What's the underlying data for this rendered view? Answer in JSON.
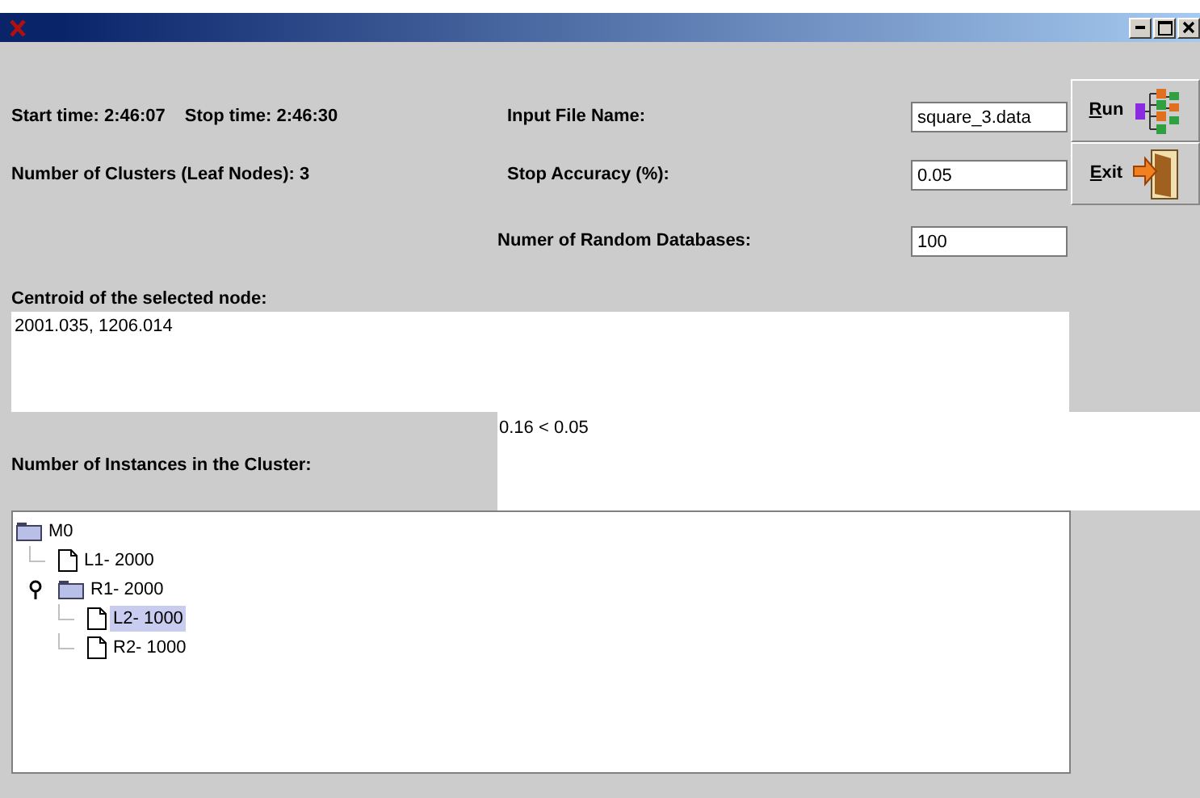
{
  "start_time": "Start time: 2:46:07",
  "stop_time": "Stop time: 2:46:30",
  "clusters": "Number of Clusters (Leaf Nodes): 3",
  "fields": [
    {
      "label": "Input File Name:",
      "value": "square_3.data"
    },
    {
      "label": "Stop Accuracy (%):",
      "value": "0.05"
    },
    {
      "label": "Numer of Random Databases:",
      "value": "100"
    }
  ],
  "buttons": [
    {
      "mnemonic": "R",
      "rest": "un",
      "kind": "run"
    },
    {
      "mnemonic": "E",
      "rest": "xit",
      "kind": "exit"
    }
  ],
  "centroid": {
    "label": "Centroid of the selected node:",
    "value": "2001.035, 1206.014"
  },
  "instances": {
    "label": "Number of Instances in the Cluster:",
    "result": "0.16 < 0.05"
  },
  "tree": [
    {
      "label": "M0",
      "kind": "folder",
      "selected": false,
      "children": [
        {
          "label": "L1- 2000",
          "kind": "leaf",
          "selected": false
        },
        {
          "label": "R1- 2000",
          "kind": "folder",
          "selected": false,
          "children": [
            {
              "label": "L2- 1000",
              "kind": "leaf",
              "selected": true
            },
            {
              "label": "R2- 1000",
              "kind": "leaf",
              "selected": false
            }
          ]
        }
      ]
    }
  ]
}
